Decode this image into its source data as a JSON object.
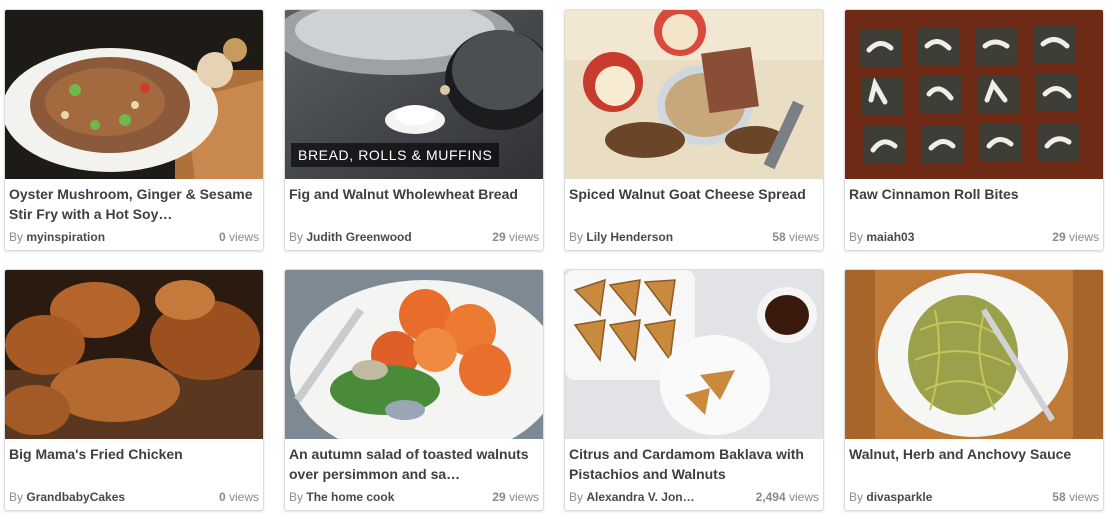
{
  "by_label": "By",
  "views_label": "views",
  "recipes": [
    {
      "title": "Oyster Mushroom, Ginger & Sesame Stir Fry with a Hot Soy…",
      "author": "myinspiration",
      "views": "0",
      "category": "",
      "image": "stir-fry-noodles-image"
    },
    {
      "title": "Fig and Walnut Wholewheat Bread",
      "author": "Judith Greenwood",
      "views": "29",
      "category": "BREAD, ROLLS & MUFFINS",
      "image": "flour-and-pot-image"
    },
    {
      "title": "Spiced Walnut Goat Cheese Spread",
      "author": "Lily Henderson",
      "views": "58",
      "category": "",
      "image": "walnut-spread-image"
    },
    {
      "title": "Raw Cinnamon Roll Bites",
      "author": "maiah03",
      "views": "29",
      "category": "",
      "image": "cinnamon-bites-image"
    },
    {
      "title": "Big Mama's Fried Chicken",
      "author": "GrandbabyCakes",
      "views": "0",
      "category": "",
      "image": "fried-chicken-image"
    },
    {
      "title": "An autumn salad of toasted walnuts over persimmon and sa…",
      "author": "The home cook",
      "views": "29",
      "category": "",
      "image": "persimmon-salad-image"
    },
    {
      "title": "Citrus and Cardamom Baklava with Pistachios and Walnuts",
      "author": "Alexandra V. Jon…",
      "views": "2,494",
      "category": "",
      "image": "baklava-image"
    },
    {
      "title": "Walnut, Herb and Anchovy Sauce",
      "author": "divasparkle",
      "views": "58",
      "category": "",
      "image": "pesto-spaghetti-image"
    }
  ]
}
